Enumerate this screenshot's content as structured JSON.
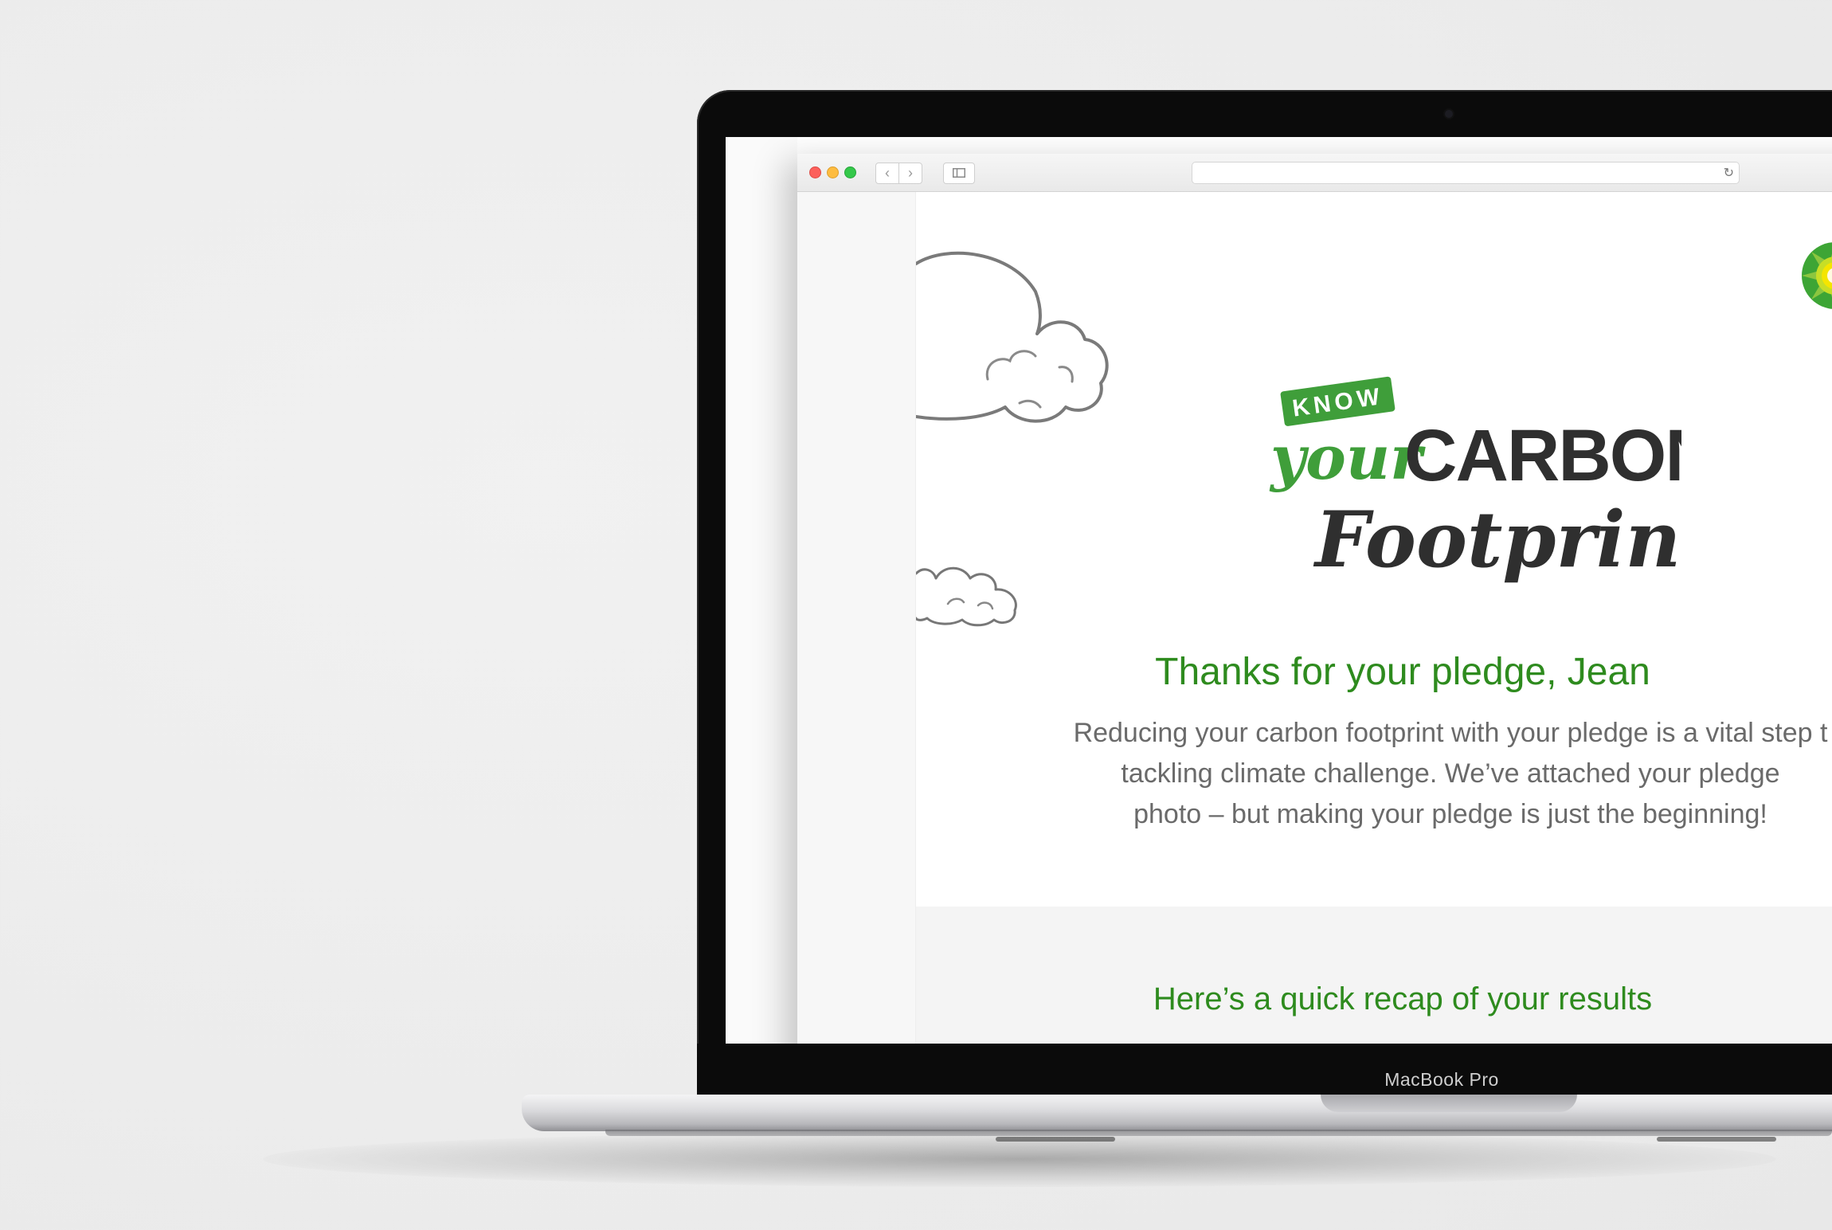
{
  "device": {
    "model_label": "MacBook Pro"
  },
  "browser": {
    "nav_back_glyph": "‹",
    "nav_forward_glyph": "›",
    "reload_glyph": "↻",
    "url_value": ""
  },
  "email": {
    "logo_badge": "KNOW",
    "logo_word_your": "your",
    "logo_word_carbon": "CARBON",
    "logo_word_footprint": "Footprint",
    "headline": "Thanks for your pledge, Jean",
    "body_line_1": "Reducing your carbon footprint with your pledge is a vital step t",
    "body_line_2": "tackling climate challenge. We’ve attached your pledge",
    "body_line_3": "photo – but making your pledge is just the beginning!",
    "recap_title": "Here’s a quick recap of your results"
  },
  "colors": {
    "brand_green": "#2e8b1e",
    "logo_green": "#3f9e3a",
    "logo_dark": "#2f2f2f",
    "bp_yellow": "#f4e500",
    "bp_green": "#3da535"
  },
  "icons": [
    "sidebar-toggle-icon",
    "reload-icon",
    "bp-helios-logo",
    "cloud-illustration"
  ]
}
